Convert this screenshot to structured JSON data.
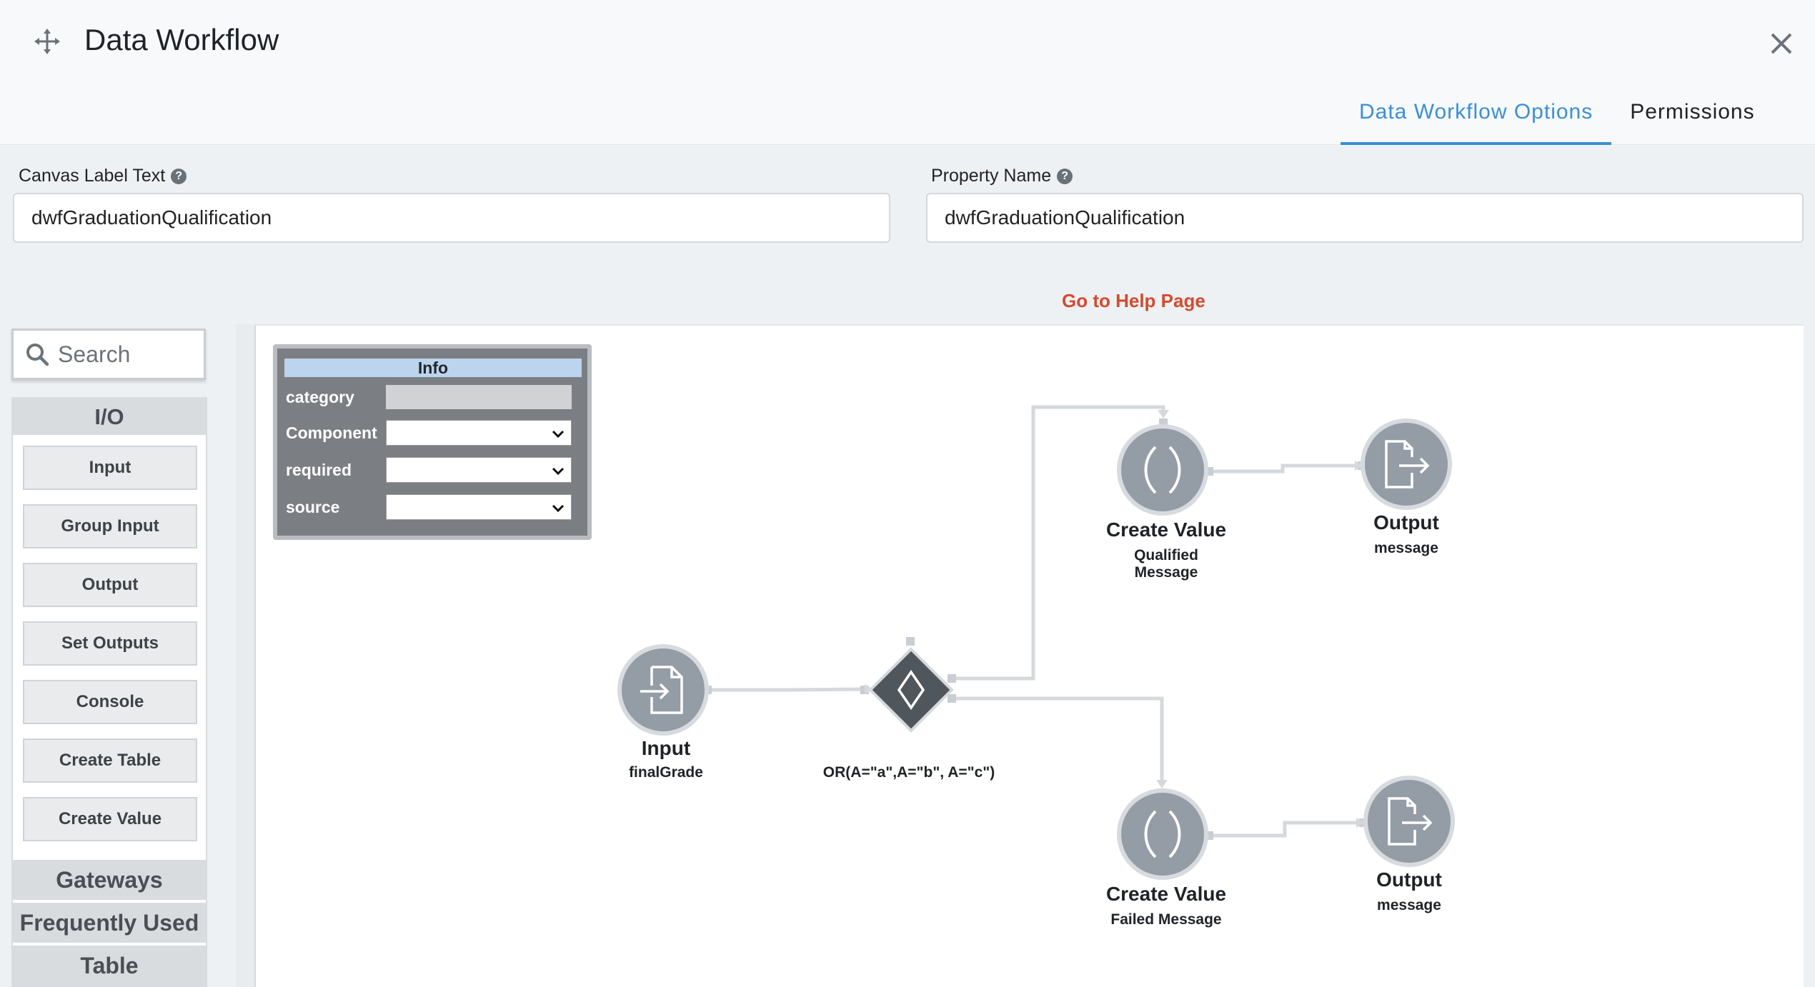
{
  "header": {
    "title": "Data Workflow",
    "tabs": [
      {
        "label": "Data Workflow Options",
        "active": true
      },
      {
        "label": "Permissions",
        "active": false
      }
    ]
  },
  "fields": {
    "canvas_label": {
      "label": "Canvas Label Text",
      "value": "dwfGraduationQualification"
    },
    "property_name": {
      "label": "Property Name",
      "value": "dwfGraduationQualification"
    }
  },
  "help_link": "Go to Help Page",
  "palette": {
    "search_placeholder": "Search",
    "sections": [
      {
        "label": "I/O",
        "items": [
          "Input",
          "Group Input",
          "Output",
          "Set Outputs",
          "Console",
          "Create Table",
          "Create Value"
        ]
      },
      {
        "label": "Gateways"
      },
      {
        "label": "Frequently Used"
      },
      {
        "label": "Table"
      }
    ]
  },
  "info_panel": {
    "title": "Info",
    "rows": [
      "category",
      "Component",
      "required",
      "source"
    ]
  },
  "nodes": {
    "input": {
      "type": "Input",
      "sub": "finalGrade"
    },
    "gateway": {
      "expr": "OR(A=\"a\",A=\"b\", A=\"c\")"
    },
    "create_qualified": {
      "type": "Create Value",
      "sub": "Qualified Message"
    },
    "output_qualified": {
      "type": "Output",
      "sub": "message"
    },
    "create_failed": {
      "type": "Create Value",
      "sub": "Failed Message"
    },
    "output_failed": {
      "type": "Output",
      "sub": "message"
    }
  },
  "colors": {
    "accent": "#3a8fd6",
    "help_link": "#d64a2e",
    "node_fill": "#949ca5",
    "gateway_fill": "#4f565c"
  }
}
